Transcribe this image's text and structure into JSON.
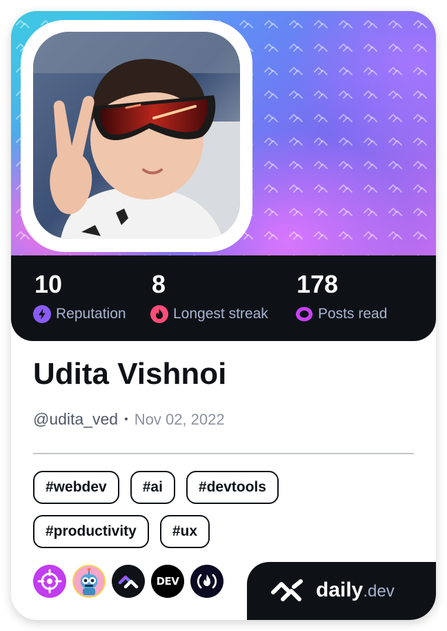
{
  "profile": {
    "name": "Udita Vishnoi",
    "username": "@udita_ved",
    "separator": "•",
    "joined": "Nov 02, 2022"
  },
  "stats": [
    {
      "value": "10",
      "label": "Reputation",
      "icon": "lightning-icon",
      "color": "#8a5cf6"
    },
    {
      "value": "8",
      "label": "Longest streak",
      "icon": "flame-icon",
      "color": "#ff4d79"
    },
    {
      "value": "178",
      "label": "Posts read",
      "icon": "eye-ring-icon",
      "color": "#c941f5"
    }
  ],
  "tags": [
    "#webdev",
    "#ai",
    "#devtools",
    "#productivity",
    "#ux"
  ],
  "sources": [
    {
      "icon": "crosshair-source-icon",
      "color": "#c23cf0"
    },
    {
      "icon": "robot-source-icon",
      "color": "#f3d44d"
    },
    {
      "icon": "dailydev-source-icon",
      "color": "#0e1217"
    },
    {
      "icon": "dev-source-icon",
      "text": "DEV",
      "color": "#000000"
    },
    {
      "icon": "fire-brackets-source-icon",
      "color": "#0a0a23"
    }
  ],
  "brand": {
    "daily": "daily",
    "dev": ".dev"
  },
  "colors": {
    "dark": "#0e1217",
    "muted": "#a8b3cf"
  }
}
